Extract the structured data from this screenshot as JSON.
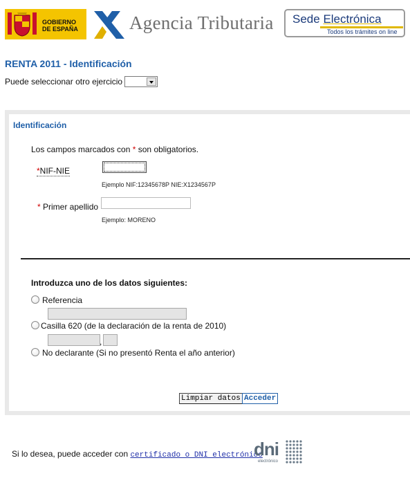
{
  "header": {
    "gobierno_line1": "GOBIERNO",
    "gobierno_line2": "DE ESPAÑA",
    "agency_name": "Agencia Tributaria",
    "sede_title_1": "Sede ",
    "sede_title_2": "Electrónica",
    "sede_subtitle": "Todos los trámites on line"
  },
  "page_title": "RENTA 2011 - Identificación",
  "ejercicio": {
    "label": "Puede seleccionar otro ejercicio",
    "selected": ""
  },
  "form": {
    "section_title": "Identificación",
    "required_note_prefix": "Los campos marcados con ",
    "required_star": "*",
    "required_note_suffix": " son obligatorios.",
    "nif_label": "NIF-NIE",
    "nif_value": "",
    "nif_example": "Ejemplo NIF:12345678P NIE:X1234567P",
    "apellido_label": "Primer apellido",
    "apellido_value": "",
    "apellido_example": "Ejemplo: MORENO",
    "intro": "Introduzca uno de los datos siguientes:",
    "options": [
      {
        "label": "Referencia",
        "selected": false
      },
      {
        "label": "Casilla 620 (de la declaración de la renta de 2010)",
        "selected": false
      },
      {
        "label": "No declarante  (Si no presentó Renta el año anterior)",
        "selected": false
      }
    ],
    "casilla_separator": ",",
    "clear_button": "Limpiar datos",
    "submit_button": "Acceder"
  },
  "footer": {
    "text": "Si lo desea, puede acceder con ",
    "link": "certificado o DNI electrónico",
    "dni_logo": "dni",
    "dni_logo_sub": "electrónico"
  },
  "colors": {
    "accent": "#1f5fa8",
    "required": "#d00000",
    "gov_yellow": "#f4c400"
  }
}
